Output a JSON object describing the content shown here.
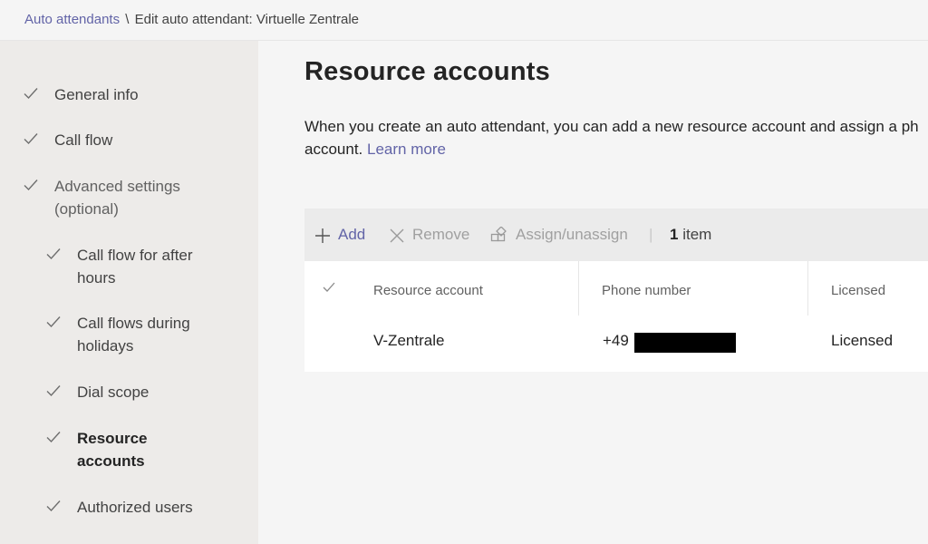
{
  "breadcrumb": {
    "root": "Auto attendants",
    "separator": "\\",
    "current": "Edit auto attendant: Virtuelle Zentrale"
  },
  "sidebar": {
    "items": [
      {
        "label": "General info"
      },
      {
        "label": "Call flow"
      },
      {
        "label": "Advanced settings (optional)"
      },
      {
        "label": "Call flow for after hours"
      },
      {
        "label": "Call flows during holidays"
      },
      {
        "label": "Dial scope"
      },
      {
        "label": "Resource accounts"
      },
      {
        "label": "Authorized users"
      }
    ]
  },
  "main": {
    "title": "Resource accounts",
    "description": "When you create an auto attendant, you can add a new resource account and assign a ph",
    "description_line2": "account.",
    "learn_more": "Learn more"
  },
  "toolbar": {
    "add": "Add",
    "remove": "Remove",
    "assign": "Assign/unassign",
    "separator": "|",
    "count": "1",
    "count_suffix": "item"
  },
  "table": {
    "columns": [
      "Resource account",
      "Phone number",
      "Licensed"
    ],
    "rows": [
      {
        "resource_account": "V-Zentrale",
        "phone_number": "+49",
        "licensed": "Licensed"
      }
    ]
  },
  "colors": {
    "accent": "#6264a7",
    "sidebar_bg": "#edebe9",
    "page_bg": "#f5f5f5",
    "disabled": "#a0a0a0"
  }
}
